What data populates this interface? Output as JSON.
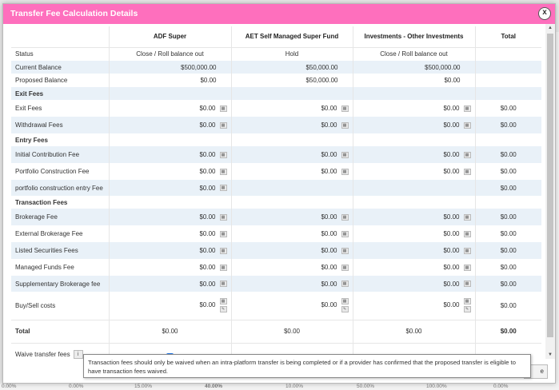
{
  "dialog": {
    "title": "Transfer Fee Calculation Details",
    "close_glyph": "x"
  },
  "columns": {
    "label": "",
    "c1": "ADF Super",
    "c2": "AET Self Managed Super Fund",
    "c3": "Investments - Other Investments",
    "total": "Total"
  },
  "rows": {
    "status": {
      "label": "Status",
      "c1": "Close / Roll balance out",
      "c2": "Hold",
      "c3": "Close / Roll balance out",
      "total": ""
    },
    "current_balance": {
      "label": "Current Balance",
      "c1": "$500,000.00",
      "c2": "$50,000.00",
      "c3": "$500,000.00",
      "total": ""
    },
    "proposed_balance": {
      "label": "Proposed Balance",
      "c1": "$0.00",
      "c2": "$50,000.00",
      "c3": "$0.00",
      "total": ""
    },
    "exit_fees_header": {
      "label": "Exit Fees"
    },
    "exit_fees": {
      "label": "Exit Fees",
      "c1": "$0.00",
      "c2": "$0.00",
      "c3": "$0.00",
      "total": "$0.00"
    },
    "withdrawal_fees": {
      "label": "Withdrawal Fees",
      "c1": "$0.00",
      "c2": "$0.00",
      "c3": "$0.00",
      "total": "$0.00"
    },
    "entry_fees_header": {
      "label": "Entry Fees"
    },
    "initial_contribution_fee": {
      "label": "Initial Contribution Fee",
      "c1": "$0.00",
      "c2": "$0.00",
      "c3": "$0.00",
      "total": "$0.00"
    },
    "portfolio_construction_fee": {
      "label": "Portfolio Construction Fee",
      "c1": "$0.00",
      "c2": "$0.00",
      "c3": "$0.00",
      "total": "$0.00"
    },
    "portfolio_construction_entry_fee": {
      "label": "portfolio construction entry Fee",
      "c1": "$0.00",
      "total": "$0.00"
    },
    "transaction_fees_header": {
      "label": "Transaction Fees"
    },
    "brokerage_fee": {
      "label": "Brokerage Fee",
      "c1": "$0.00",
      "c2": "$0.00",
      "c3": "$0.00",
      "total": "$0.00"
    },
    "external_brokerage_fee": {
      "label": "External Brokerage Fee",
      "c1": "$0.00",
      "c2": "$0.00",
      "c3": "$0.00",
      "total": "$0.00"
    },
    "listed_securities_fees": {
      "label": "Listed Securities Fees",
      "c1": "$0.00",
      "c2": "$0.00",
      "c3": "$0.00",
      "total": "$0.00"
    },
    "managed_funds_fee": {
      "label": "Managed Funds Fee",
      "c1": "$0.00",
      "c2": "$0.00",
      "c3": "$0.00",
      "total": "$0.00"
    },
    "supplementary_brokerage_fee": {
      "label": "Supplementary Brokerage fee",
      "c1": "$0.00",
      "c2": "$0.00",
      "c3": "$0.00",
      "total": "$0.00"
    },
    "buy_sell_costs": {
      "label": "Buy/Sell costs",
      "c1": "$0.00",
      "c2": "$0.00",
      "c3": "$0.00",
      "total": "$0.00"
    },
    "total": {
      "label": "Total",
      "c1": "$0.00",
      "c2": "$0.00",
      "c3": "$0.00",
      "total": "$0.00"
    }
  },
  "waive": {
    "label": "Waive transfer fees",
    "info_glyph": "i",
    "checked": true,
    "check_glyph": "✓"
  },
  "tooltip": {
    "text": "Transaction fees should only be waived when an intra-platform transfer is being completed or if a provider has confirmed that the proposed transfer is eligible to have transaction fees waived."
  },
  "footer": {
    "button_fragment": "e"
  },
  "background": {
    "percent_labels": [
      "0.00%",
      "0.00%",
      "15.00%",
      "40.00%",
      "10.00%",
      "50.00%",
      "100.00%",
      "0.00%"
    ]
  },
  "colors": {
    "title_bar": "#fe6fbd",
    "row_shade": "#e9f1f8",
    "checkbox": "#1a73e8"
  }
}
